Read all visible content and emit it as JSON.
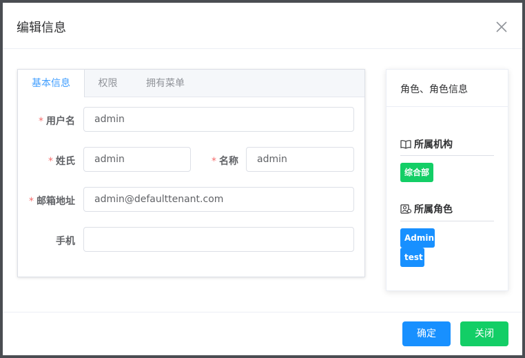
{
  "dialog": {
    "title": "编辑信息"
  },
  "tabs": [
    {
      "label": "基本信息",
      "active": true
    },
    {
      "label": "权限",
      "active": false
    },
    {
      "label": "拥有菜单",
      "active": false
    }
  ],
  "form": {
    "username": {
      "label": "用户名",
      "required": "*",
      "value": "admin"
    },
    "surname": {
      "label": "姓氏",
      "required": "*",
      "value": "admin"
    },
    "name": {
      "label": "名称",
      "required": "*",
      "value": "admin"
    },
    "email": {
      "label": "邮箱地址",
      "required": "*",
      "value": "admin@defaulttenant.com"
    },
    "phone": {
      "label": "手机",
      "value": ""
    }
  },
  "role_panel": {
    "title": "角色、角色信息",
    "org_section": {
      "title": "所属机构",
      "icon": "book-icon",
      "tags": [
        "综合部"
      ]
    },
    "role_section": {
      "title": "所属角色",
      "icon": "user-card-icon",
      "tags": [
        "Admin",
        "test"
      ]
    }
  },
  "footer": {
    "ok_label": "确定",
    "close_label": "关闭"
  },
  "colors": {
    "primary": "#1890ff",
    "success": "#13ce66",
    "tab_active": "#409eff",
    "required": "#f56c6c"
  }
}
